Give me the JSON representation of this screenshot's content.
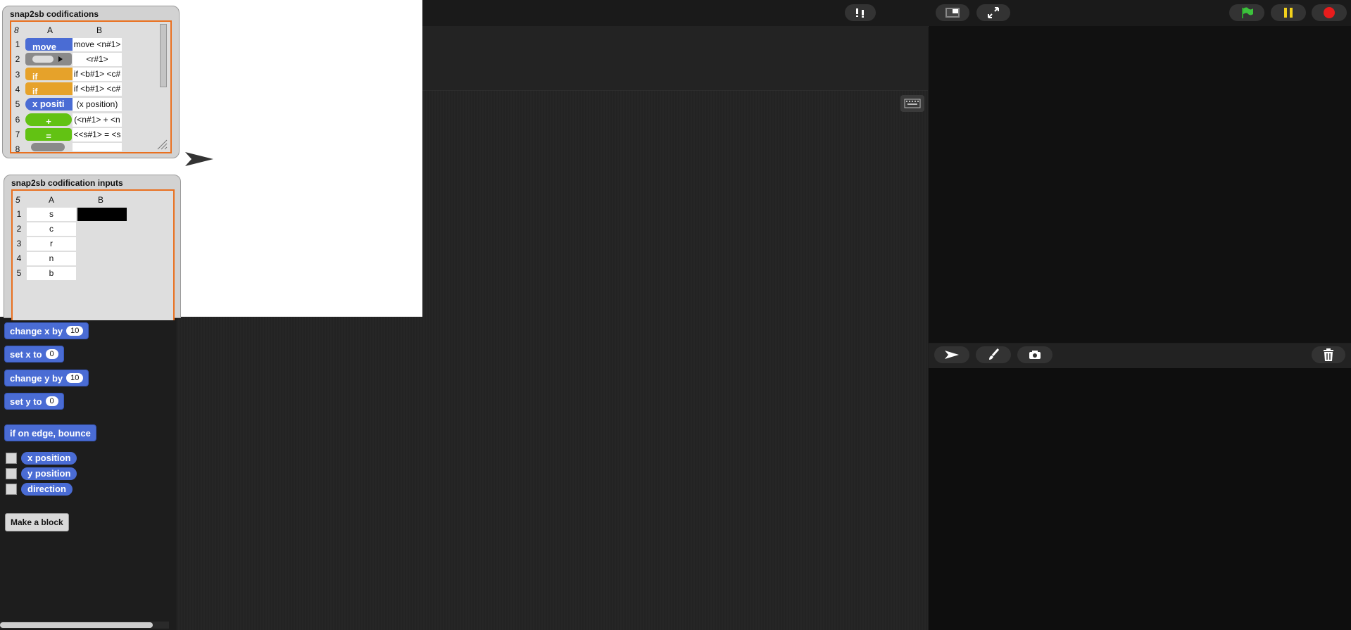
{
  "dialogs": {
    "codifications": {
      "title": "snap2sb codifications",
      "count": "8",
      "col_a": "A",
      "col_b": "B",
      "rows": [
        {
          "n": "1",
          "block": "move",
          "b": "move <n#1>"
        },
        {
          "n": "2",
          "block": "",
          "b": "<r#1>"
        },
        {
          "n": "3",
          "block": "if",
          "b": "if <b#1> <c#"
        },
        {
          "n": "4",
          "block": "if",
          "b": "if <b#1> <c#"
        },
        {
          "n": "5",
          "block": "x positi",
          "b": "(x position)"
        },
        {
          "n": "6",
          "block": "+",
          "b": "(<n#1> + <n"
        },
        {
          "n": "7",
          "block": "=",
          "b": "<<s#1> = <s"
        },
        {
          "n": "8",
          "block": "",
          "b": ""
        }
      ]
    },
    "inputs": {
      "title": "snap2sb codification inputs",
      "count": "5",
      "col_a": "A",
      "col_b": "B",
      "rows": [
        {
          "n": "1",
          "a": "s"
        },
        {
          "n": "2",
          "a": "c"
        },
        {
          "n": "3",
          "a": "r"
        },
        {
          "n": "4",
          "a": "n"
        },
        {
          "n": "5",
          "a": "b"
        }
      ]
    }
  },
  "palette": {
    "change_x": {
      "label": "change x by",
      "value": "10"
    },
    "set_x": {
      "label": "set x to",
      "value": "0"
    },
    "change_y": {
      "label": "change y by",
      "value": "10"
    },
    "set_y": {
      "label": "set y to",
      "value": "0"
    },
    "bounce": {
      "label": "if on edge, bounce"
    },
    "x_position": "x position",
    "y_position": "y position",
    "direction": "direction",
    "make_block": "Make a block"
  },
  "colors": {
    "motion": "#4a6cd4",
    "control": "#e6a22a",
    "operators": "#62c213",
    "accent": "#e9701f"
  }
}
